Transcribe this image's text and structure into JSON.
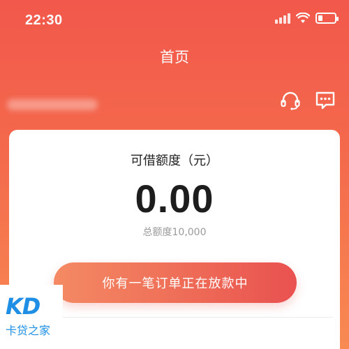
{
  "status_bar": {
    "time": "22:30"
  },
  "header": {
    "title": "首页",
    "icons": [
      "headset-icon",
      "message-icon"
    ]
  },
  "card": {
    "label": "可借额度（元）",
    "amount": "0.00",
    "total": "总额度10,000",
    "action_button": "你有一笔订单正在放款中"
  },
  "watermark": {
    "logo": "KD",
    "text": "卡贷之家"
  },
  "colors": {
    "header_gradient_top": "#f2584b",
    "header_gradient_bottom": "#f88a52",
    "button_left": "#f48a64",
    "button_right": "#e95150",
    "watermark_blue": "#1f8fe6"
  }
}
